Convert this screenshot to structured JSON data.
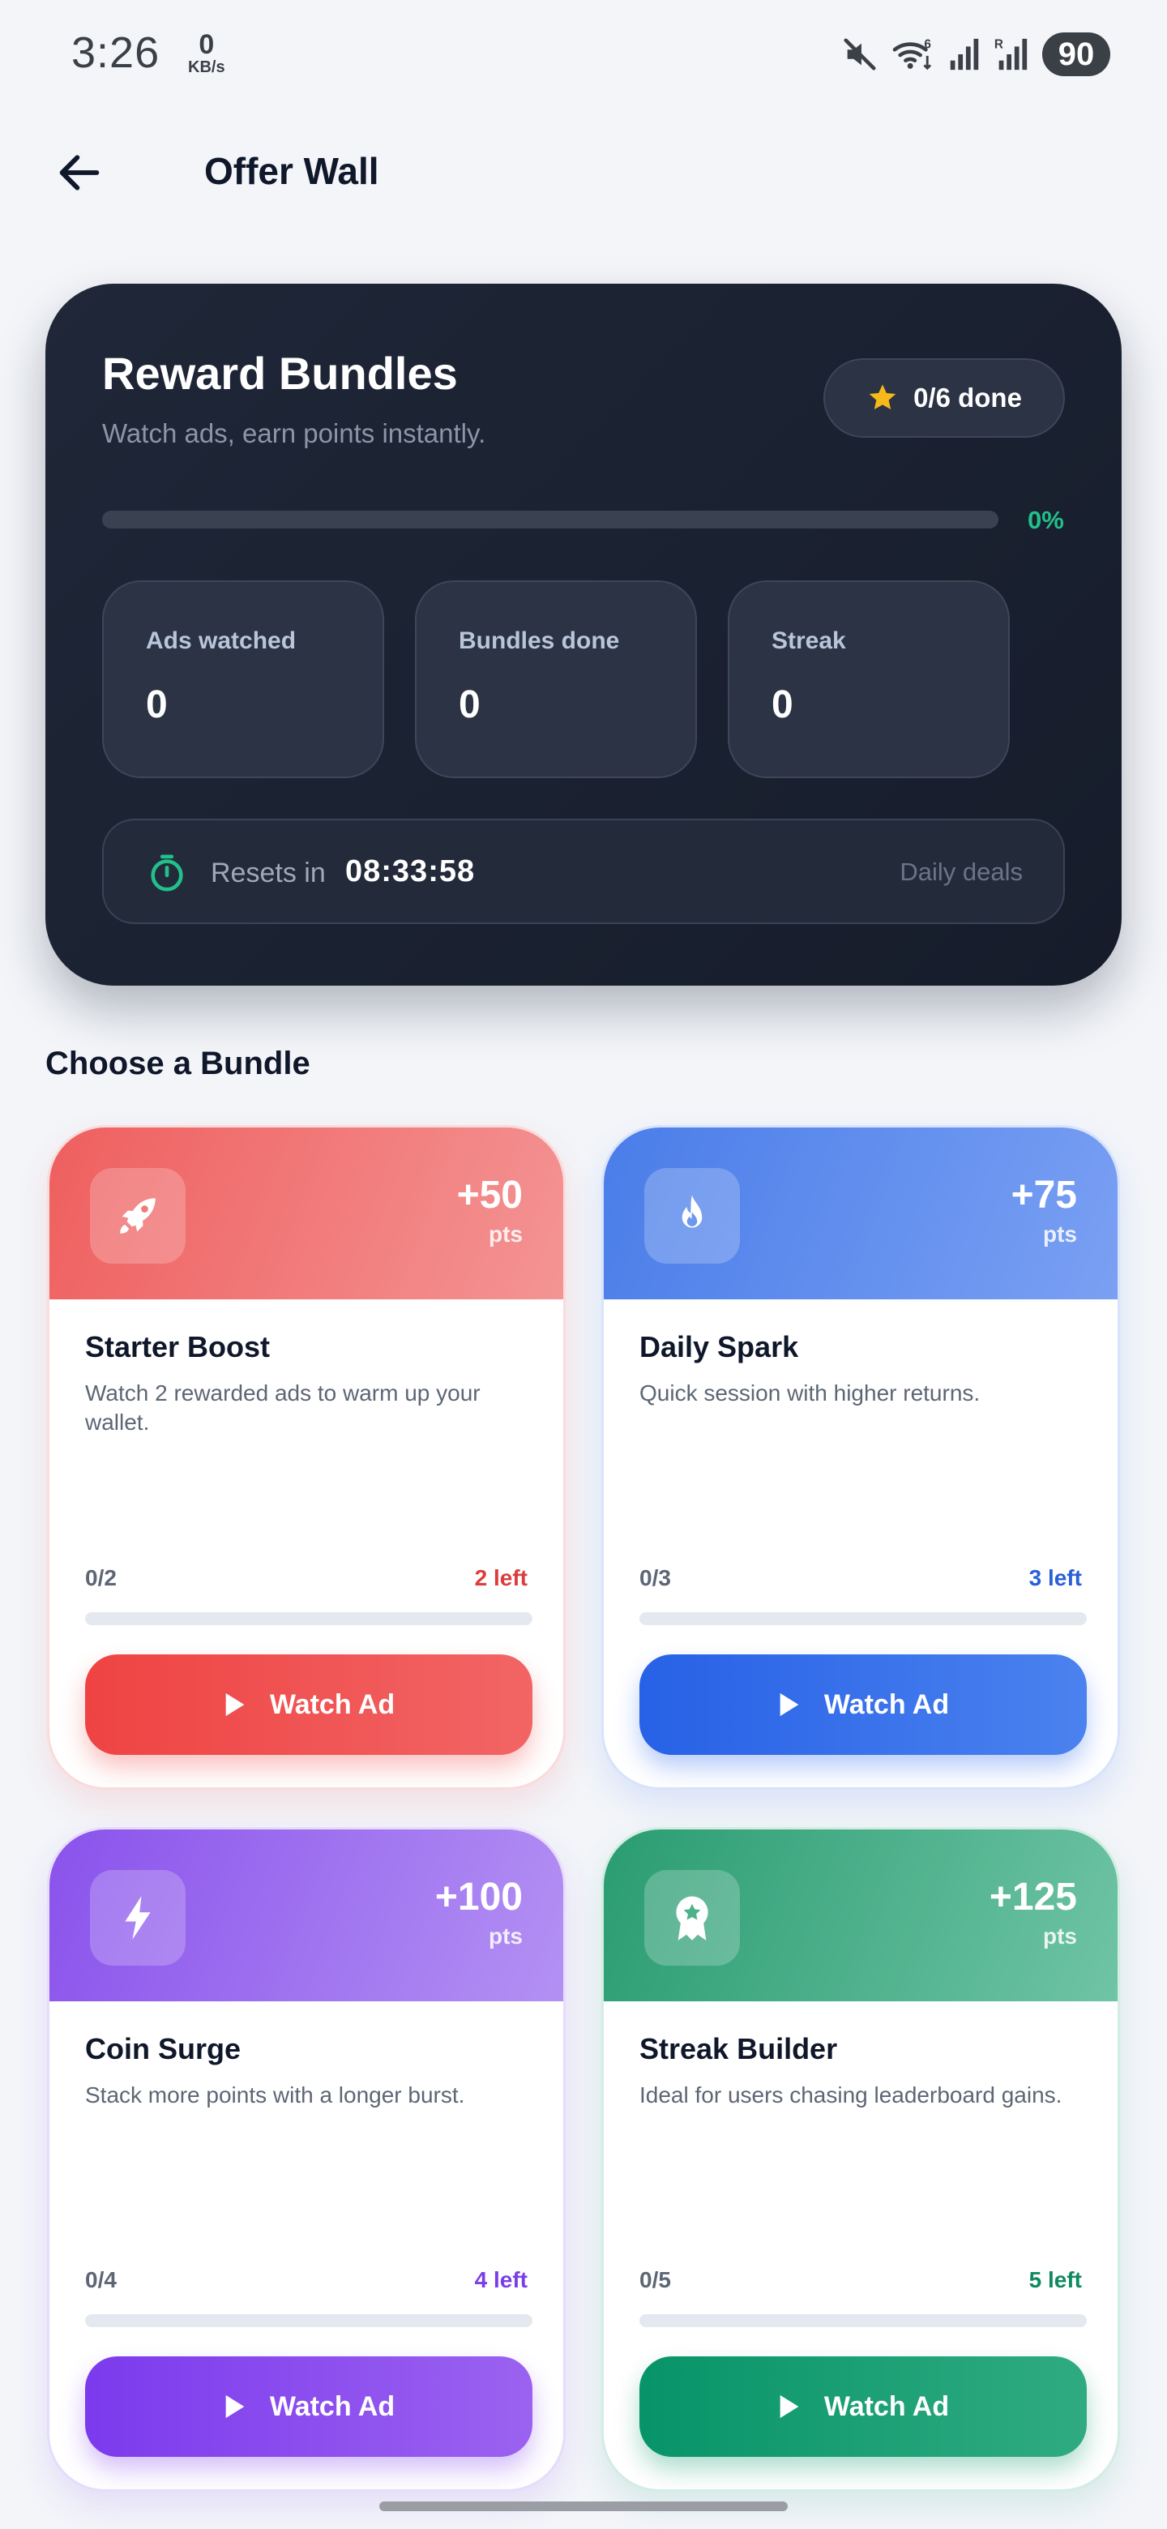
{
  "status_bar": {
    "time": "3:26",
    "speed_value": "0",
    "speed_unit": "KB/s",
    "battery": "90",
    "icons": [
      "mute-icon",
      "wifi-icon",
      "signal-icon",
      "roaming-signal-icon"
    ]
  },
  "header": {
    "title": "Offer Wall",
    "back_icon": "arrow-left-icon"
  },
  "hero": {
    "title": "Reward Bundles",
    "subtitle": "Watch ads, earn points instantly.",
    "done_label": "0/6 done",
    "progress_fraction": 0,
    "progress_label": "0%",
    "stats": [
      {
        "label": "Ads watched",
        "value": "0"
      },
      {
        "label": "Bundles done",
        "value": "0"
      },
      {
        "label": "Streak",
        "value": "0"
      }
    ],
    "reset_label": "Resets in",
    "reset_time": "08:33:58",
    "reset_tag": "Daily deals"
  },
  "section_title": "Choose a Bundle",
  "bundles": [
    {
      "name": "Starter Boost",
      "description": "Watch 2 rewarded ads to warm up your wallet.",
      "points": "+50",
      "points_unit": "pts",
      "count": "0/2",
      "remaining": "2 left",
      "progress_fraction": 0,
      "button": "Watch Ad",
      "icon": "rocket-icon",
      "accent": "#ef4444"
    },
    {
      "name": "Daily Spark",
      "description": "Quick session with higher returns.",
      "points": "+75",
      "points_unit": "pts",
      "count": "0/3",
      "remaining": "3 left",
      "progress_fraction": 0,
      "button": "Watch Ad",
      "icon": "flame-icon",
      "accent": "#2563eb"
    },
    {
      "name": "Coin Surge",
      "description": "Stack more points with a longer burst.",
      "points": "+100",
      "points_unit": "pts",
      "count": "0/4",
      "remaining": "4 left",
      "progress_fraction": 0,
      "button": "Watch Ad",
      "icon": "bolt-icon",
      "accent": "#7c3aed"
    },
    {
      "name": "Streak Builder",
      "description": "Ideal for users chasing leaderboard gains.",
      "points": "+125",
      "points_unit": "pts",
      "count": "0/5",
      "remaining": "5 left",
      "progress_fraction": 0,
      "button": "Watch Ad",
      "icon": "badge-icon",
      "accent": "#059669"
    }
  ]
}
